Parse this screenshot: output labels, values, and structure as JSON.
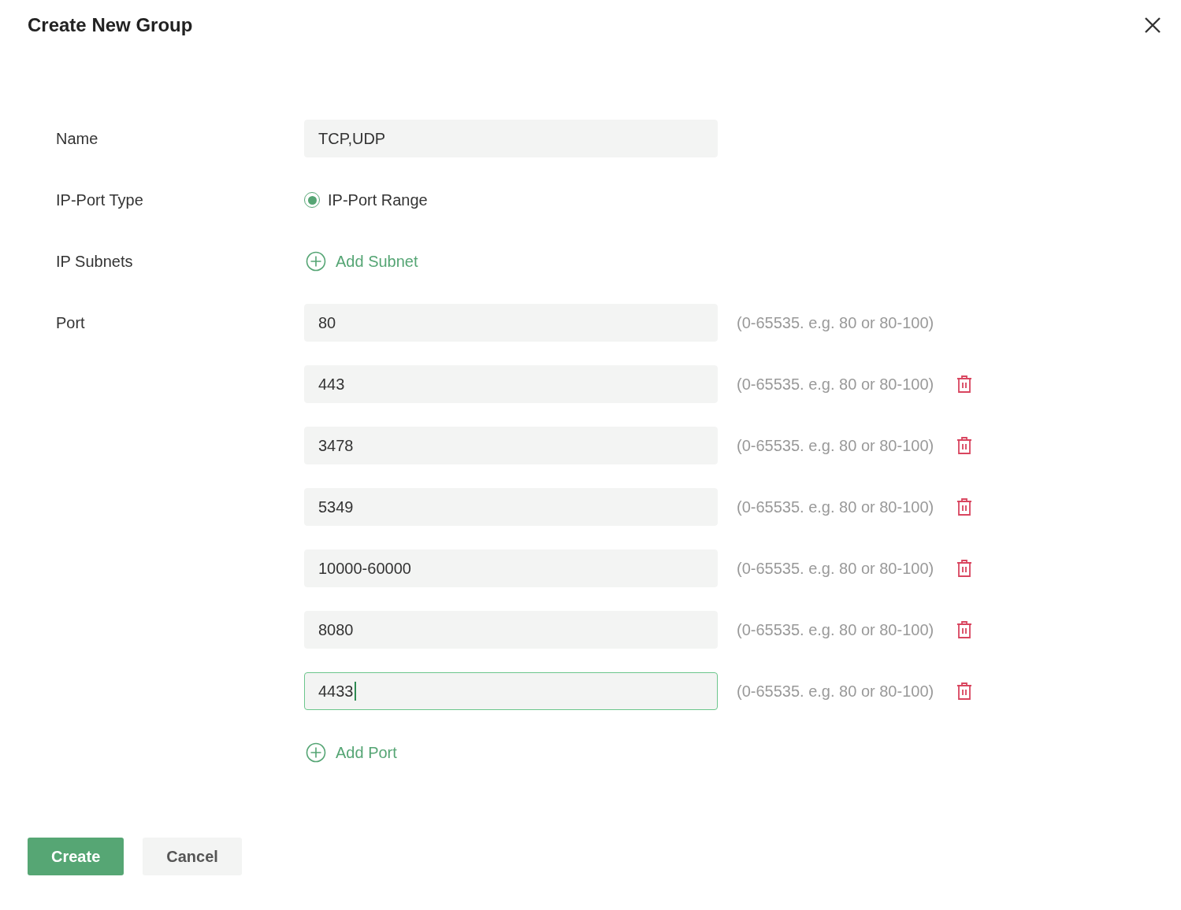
{
  "dialog": {
    "title": "Create New Group"
  },
  "form": {
    "name": {
      "label": "Name",
      "value": "TCP,UDP"
    },
    "ip_port_type": {
      "label": "IP-Port Type",
      "options": [
        {
          "label": "IP-Port Range",
          "selected": true
        }
      ]
    },
    "ip_subnets": {
      "label": "IP Subnets",
      "add_link": "Add Subnet"
    },
    "port": {
      "label": "Port",
      "add_link": "Add Port",
      "entries": [
        {
          "value": "80",
          "hint": "(0-65535. e.g. 80 or 80-100)",
          "removable": false,
          "focused": false
        },
        {
          "value": "443",
          "hint": "(0-65535. e.g. 80 or 80-100)",
          "removable": true,
          "focused": false
        },
        {
          "value": "3478",
          "hint": "(0-65535. e.g. 80 or 80-100)",
          "removable": true,
          "focused": false
        },
        {
          "value": "5349",
          "hint": "(0-65535. e.g. 80 or 80-100)",
          "removable": true,
          "focused": false
        },
        {
          "value": "10000-60000",
          "hint": "(0-65535. e.g. 80 or 80-100)",
          "removable": true,
          "focused": false
        },
        {
          "value": "8080",
          "hint": "(0-65535. e.g. 80 or 80-100)",
          "removable": true,
          "focused": false
        },
        {
          "value": "4433",
          "hint": "(0-65535. e.g. 80 or 80-100)",
          "removable": true,
          "focused": true
        }
      ]
    }
  },
  "buttons": [
    {
      "label": "Create",
      "kind": "primary"
    },
    {
      "label": "Cancel",
      "kind": "secondary"
    }
  ]
}
